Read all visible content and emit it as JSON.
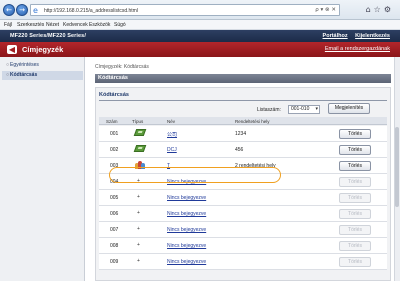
{
  "browser": {
    "url": "http://192.168.0.215/a_addresslistcsd.html",
    "url_tools": "ρ ▾ ⊗ ✕",
    "back_icon": "back-arrow-icon",
    "forward_icon": "forward-arrow-icon"
  },
  "menubar": {
    "items": [
      "Fájl",
      "Szerkesztés",
      "Nézet",
      "Kedvencek",
      "Eszközök",
      "Súgó"
    ]
  },
  "header": {
    "model": "MF220 Series/MF220 Series/",
    "links": [
      "Portálhoz",
      "Kijelentkezés"
    ],
    "page_title": "Címjegyzék",
    "mail_link": "Email a rendszergazdának"
  },
  "sidebar": {
    "items": [
      {
        "label": "Egyérintéses"
      },
      {
        "label": "Kódtárcsás"
      }
    ]
  },
  "main": {
    "breadcrumb": "Címjegyzék: Kódtárcsás",
    "section_title": "Kódtárcsás",
    "panel_title": "Kódtárcsás",
    "list_label": "Listaszám:",
    "list_value": "001-010",
    "show_button": "Megjelenítés",
    "columns": [
      "Szám",
      "Típus",
      "Név",
      "Rendeltetési hely"
    ],
    "delete_label": "Törlés",
    "rows": [
      {
        "num": "001",
        "type": "fax",
        "type_icon": "fax-icon",
        "name": "公司",
        "name_link": true,
        "dest": "1234",
        "delete_enabled": true
      },
      {
        "num": "002",
        "type": "fax",
        "type_icon": "fax-icon",
        "name": "DCJ",
        "name_link": true,
        "dest": "456",
        "delete_enabled": true
      },
      {
        "num": "003",
        "type": "group",
        "type_icon": "group-icon",
        "name": "T",
        "name_link": true,
        "dest": "2 rendeltetési hely",
        "delete_enabled": true
      },
      {
        "num": "004",
        "type": "none",
        "type_icon": "dash-icon",
        "type_text": "+",
        "name": "Nincs bejegyezve",
        "name_link": true,
        "dest": "",
        "delete_enabled": false
      },
      {
        "num": "005",
        "type": "none",
        "type_icon": "dash-icon",
        "type_text": "+",
        "name": "Nincs bejegyezve",
        "name_link": true,
        "dest": "",
        "delete_enabled": false
      },
      {
        "num": "006",
        "type": "none",
        "type_icon": "dash-icon",
        "type_text": "+",
        "name": "Nincs bejegyezve",
        "name_link": true,
        "dest": "",
        "delete_enabled": false
      },
      {
        "num": "007",
        "type": "none",
        "type_icon": "dash-icon",
        "type_text": "+",
        "name": "Nincs bejegyezve",
        "name_link": true,
        "dest": "",
        "delete_enabled": false
      },
      {
        "num": "008",
        "type": "none",
        "type_icon": "dash-icon",
        "type_text": "+",
        "name": "Nincs bejegyezve",
        "name_link": true,
        "dest": "",
        "delete_enabled": false
      },
      {
        "num": "009",
        "type": "none",
        "type_icon": "dash-icon",
        "type_text": "+",
        "name": "Nincs bejegyezve",
        "name_link": true,
        "dest": "",
        "delete_enabled": false
      }
    ],
    "highlighted_row": "004"
  },
  "colors": {
    "header_dark": "#1c2b48",
    "title_red": "#a11e22",
    "highlight_orange": "#f0a020",
    "link_blue": "#203a9a"
  }
}
